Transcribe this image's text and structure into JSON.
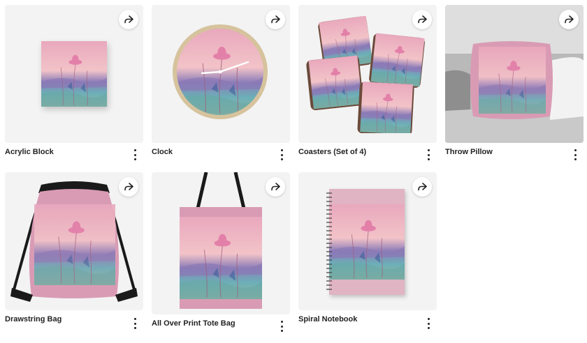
{
  "products": [
    {
      "title": "Acrylic Block",
      "image": "acrylic-block-mockup"
    },
    {
      "title": "Clock",
      "image": "wall-clock-mockup"
    },
    {
      "title": "Coasters (Set of 4)",
      "image": "coasters-mockup"
    },
    {
      "title": "Throw Pillow",
      "image": "throw-pillow-on-sofa-mockup"
    },
    {
      "title": "Drawstring Bag",
      "image": "drawstring-bag-mockup"
    },
    {
      "title": "All Over Print Tote Bag",
      "image": "tote-bag-mockup"
    },
    {
      "title": "Spiral Notebook",
      "image": "spiral-notebook-mockup"
    }
  ],
  "icons": {
    "share": "share-arrow-icon",
    "more": "more-vertical-icon"
  },
  "colors": {
    "text": "#222222",
    "thumb_bg": "#f3f3f3"
  }
}
